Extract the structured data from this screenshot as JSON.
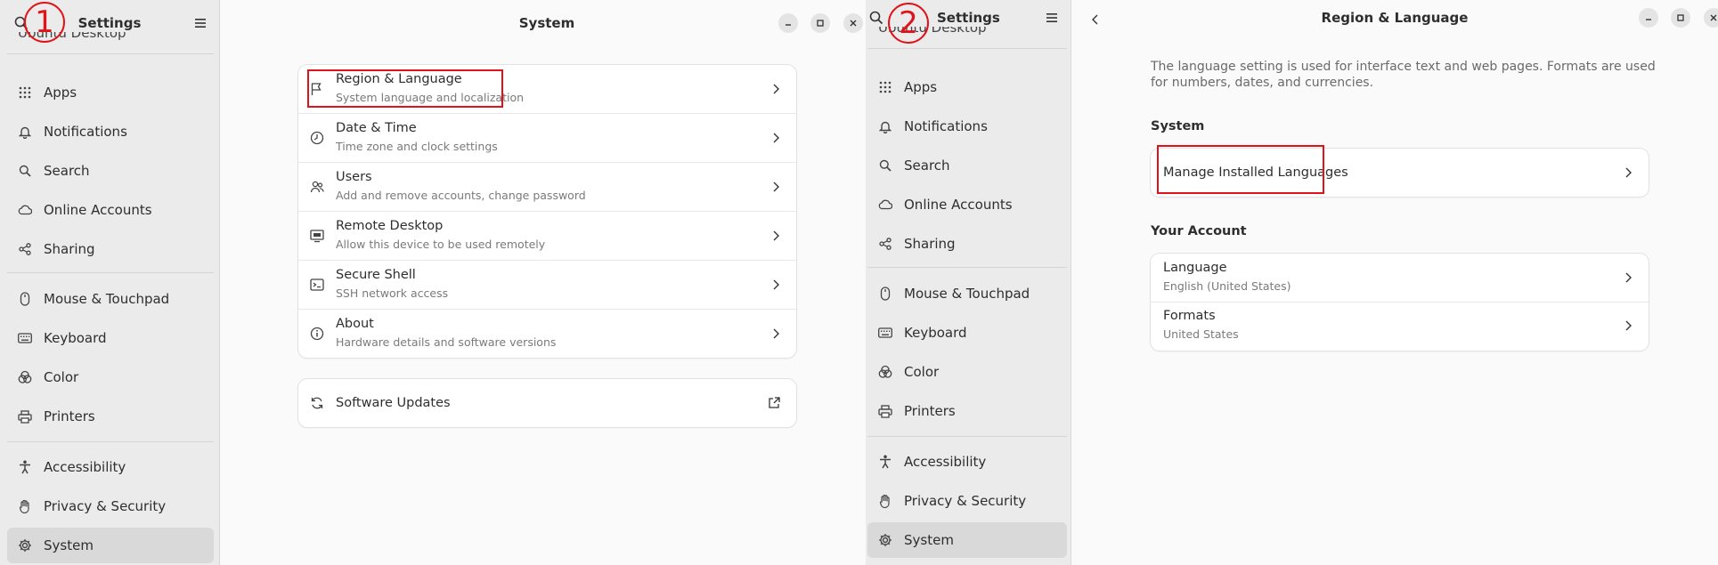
{
  "step1": {
    "badge": "1",
    "sidebar": {
      "title": "Settings",
      "clipped_item": "Ubuntu Desktop",
      "items": [
        {
          "label": "Apps",
          "icon": "apps-grid-icon"
        },
        {
          "label": "Notifications",
          "icon": "bell-icon"
        },
        {
          "label": "Search",
          "icon": "search-icon"
        },
        {
          "label": "Online Accounts",
          "icon": "cloud-icon"
        },
        {
          "label": "Sharing",
          "icon": "share-icon"
        },
        {
          "label": "Mouse & Touchpad",
          "icon": "mouse-icon"
        },
        {
          "label": "Keyboard",
          "icon": "keyboard-icon"
        },
        {
          "label": "Color",
          "icon": "color-icon"
        },
        {
          "label": "Printers",
          "icon": "printer-icon"
        },
        {
          "label": "Accessibility",
          "icon": "accessibility-icon"
        },
        {
          "label": "Privacy & Security",
          "icon": "hand-icon"
        },
        {
          "label": "System",
          "icon": "gear-icon"
        }
      ],
      "active": "System"
    },
    "main": {
      "title": "System",
      "rows": [
        {
          "title": "Region & Language",
          "subtitle": "System language and localization",
          "icon": "flag-icon"
        },
        {
          "title": "Date & Time",
          "subtitle": "Time zone and clock settings",
          "icon": "clock-icon"
        },
        {
          "title": "Users",
          "subtitle": "Add and remove accounts, change password",
          "icon": "users-icon"
        },
        {
          "title": "Remote Desktop",
          "subtitle": "Allow this device to be used remotely",
          "icon": "remote-desktop-icon"
        },
        {
          "title": "Secure Shell",
          "subtitle": "SSH network access",
          "icon": "terminal-icon"
        },
        {
          "title": "About",
          "subtitle": "Hardware details and software versions",
          "icon": "info-icon"
        }
      ],
      "updates": {
        "title": "Software Updates",
        "icon": "refresh-icon"
      }
    }
  },
  "step2": {
    "badge": "2",
    "sidebar": {
      "title": "Settings",
      "clipped_item": "Ubuntu Desktop",
      "items": [
        {
          "label": "Apps"
        },
        {
          "label": "Notifications"
        },
        {
          "label": "Search"
        },
        {
          "label": "Online Accounts"
        },
        {
          "label": "Sharing"
        },
        {
          "label": "Mouse & Touchpad"
        },
        {
          "label": "Keyboard"
        },
        {
          "label": "Color"
        },
        {
          "label": "Printers"
        },
        {
          "label": "Accessibility"
        },
        {
          "label": "Privacy & Security"
        },
        {
          "label": "System"
        }
      ],
      "active": "System"
    },
    "main": {
      "title": "Region & Language",
      "description": "The language setting is used for interface text and web pages. Formats are used for numbers, dates, and currencies.",
      "system_label": "System",
      "manage_label": "Manage Installed Languages",
      "account_label": "Your Account",
      "language": {
        "title": "Language",
        "value": "English (United States)"
      },
      "formats": {
        "title": "Formats",
        "value": "United States"
      }
    }
  },
  "colors": {
    "highlight": "#e0131a",
    "sidebar_bg": "#ebebeb",
    "active_bg": "#d9d9d9"
  }
}
